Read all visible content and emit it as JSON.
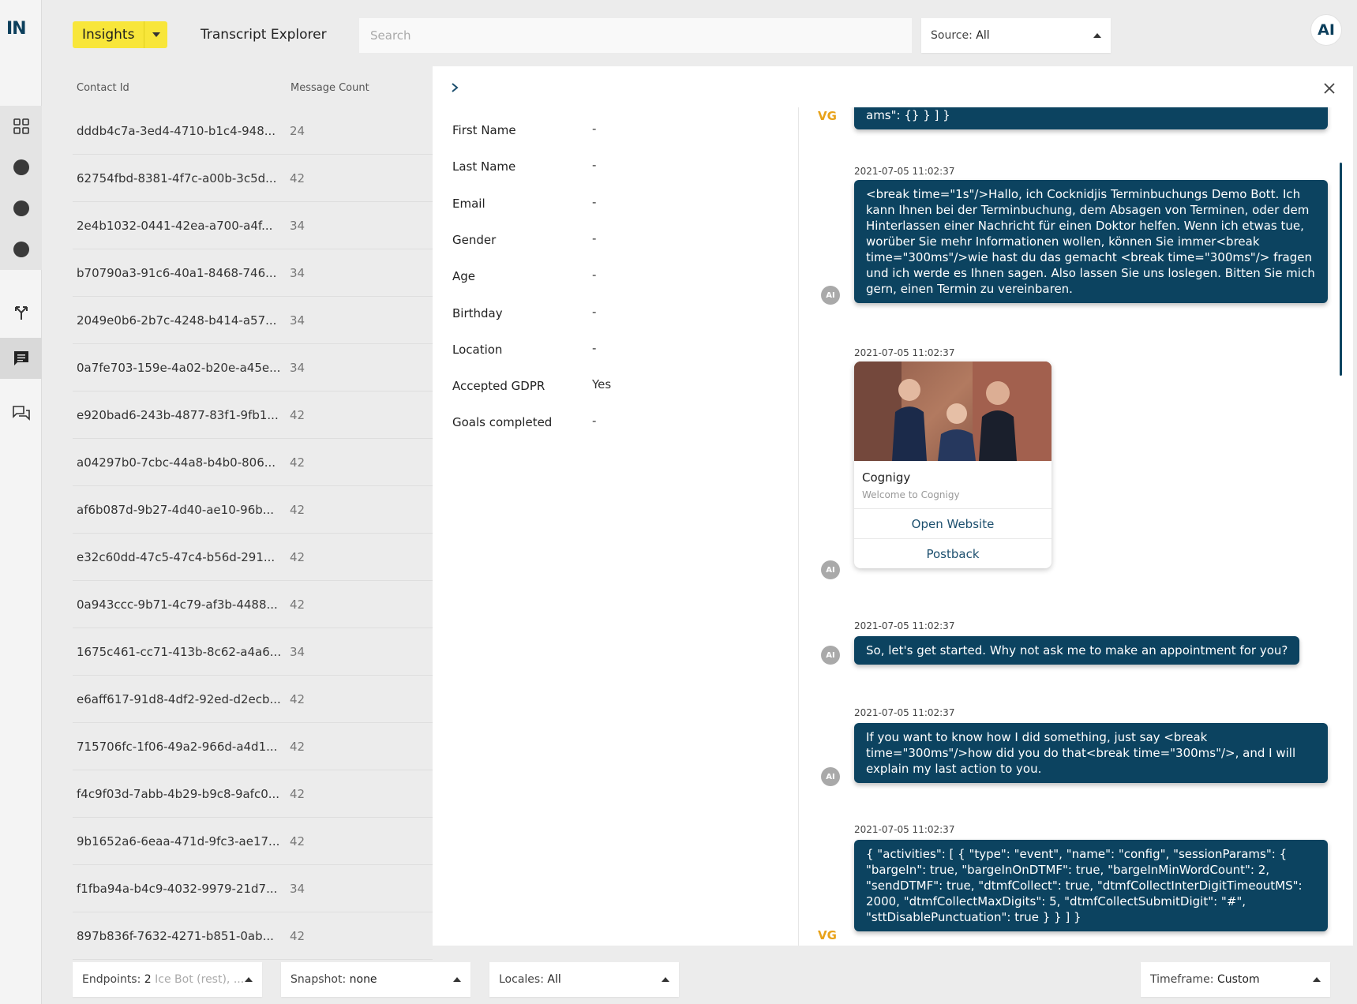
{
  "app": {
    "logo": "IN",
    "brand_logo": "AI"
  },
  "header": {
    "insights_label": "Insights",
    "title": "Transcript Explorer",
    "search_placeholder": "Search",
    "source_label": "Source:",
    "source_value": "All"
  },
  "list": {
    "col_contact": "Contact Id",
    "col_count": "Message Count",
    "rows": [
      {
        "id": "dddb4c7a-3ed4-4710-b1c4-948...",
        "count": "24"
      },
      {
        "id": "62754fbd-8381-4f7c-a00b-3c5d...",
        "count": "42"
      },
      {
        "id": "2e4b1032-0441-42ea-a700-a4f...",
        "count": "34"
      },
      {
        "id": "b70790a3-91c6-40a1-8468-746...",
        "count": "34"
      },
      {
        "id": "2049e0b6-2b7c-4248-b414-a57...",
        "count": "34"
      },
      {
        "id": "0a7fe703-159e-4a02-b20e-a45e...",
        "count": "34"
      },
      {
        "id": "e920bad6-243b-4877-83f1-9fb1...",
        "count": "42"
      },
      {
        "id": "a04297b0-7cbc-44a8-b4b0-806...",
        "count": "42"
      },
      {
        "id": "af6b087d-9b27-4d40-ae10-96b...",
        "count": "42"
      },
      {
        "id": "e32c60dd-47c5-47c4-b56d-291...",
        "count": "42"
      },
      {
        "id": "0a943ccc-9b71-4c79-af3b-4488...",
        "count": "42"
      },
      {
        "id": "1675c461-cc71-413b-8c62-a4a6...",
        "count": "34"
      },
      {
        "id": "e6aff617-91d8-4df2-92ed-d2ecb...",
        "count": "42"
      },
      {
        "id": "715706fc-1f06-49a2-966d-a4d1...",
        "count": "42"
      },
      {
        "id": "f4c9f03d-7abb-4b29-b9c8-9afc0...",
        "count": "42"
      },
      {
        "id": "9b1652a6-6eaa-471d-9fc3-ae17...",
        "count": "42"
      },
      {
        "id": "f1fba94a-b4c9-4032-9979-21d7...",
        "count": "34"
      },
      {
        "id": "897b836f-7632-4271-b851-0ab...",
        "count": "42"
      }
    ]
  },
  "profile": {
    "fields": [
      {
        "label": "First Name",
        "value": "-"
      },
      {
        "label": "Last Name",
        "value": "-"
      },
      {
        "label": "Email",
        "value": "-"
      },
      {
        "label": "Gender",
        "value": "-"
      },
      {
        "label": "Age",
        "value": "-"
      },
      {
        "label": "Birthday",
        "value": "-"
      },
      {
        "label": "Location",
        "value": "-"
      },
      {
        "label": "Accepted GDPR",
        "value": "Yes"
      },
      {
        "label": "Goals completed",
        "value": "-"
      }
    ]
  },
  "chat": {
    "avatar_ai": "AI",
    "avatar_vg": "VG",
    "msg0": "ams\": {} } ] }",
    "ts1": "2021-07-05 11:02:37",
    "msg1": "<break time=\"1s\"/>Hallo, ich Cocknidjis Terminbuchungs Demo Bott. Ich kann Ihnen bei der Terminbuchung, dem Absagen von Terminen, oder dem Hinterlassen einer Nachricht für einen Doktor helfen. Wenn ich etwas tue, worüber Sie mehr Informationen wollen, können Sie immer<break time=\"300ms\"/>wie hast du das gemacht <break time=\"300ms\"/> fragen und ich werde es Ihnen sagen. Also lassen Sie uns loslegen. Bitten Sie mich gern, einen Termin zu vereinbaren.",
    "ts2": "2021-07-05 11:02:37",
    "card": {
      "title": "Cognigy",
      "subtitle": "Welcome to Cognigy",
      "button1": "Open Website",
      "button2": "Postback"
    },
    "ts3": "2021-07-05 11:02:37",
    "msg3": "So, let's get started. Why not ask me to make an appointment for you?",
    "ts4": "2021-07-05 11:02:37",
    "msg4": "If you want to know how I did something, just say <break time=\"300ms\"/>how did you do that<break time=\"300ms\"/>, and I will explain my last action to you.",
    "ts5": "2021-07-05 11:02:37",
    "msg5": "{ \"activities\": [ { \"type\": \"event\", \"name\": \"config\", \"sessionParams\": { \"bargeIn\": true, \"bargeInOnDTMF\": true, \"bargeInMinWordCount\": 2, \"sendDTMF\": true, \"dtmfCollect\": true, \"dtmfCollectInterDigitTimeoutMS\": 2000, \"dtmfCollectMaxDigits\": 5, \"dtmfCollectSubmitDigit\": \"#\", \"sttDisablePunctuation\": true } } ] }"
  },
  "filters": {
    "endpoints_label": "Endpoints:",
    "endpoints_count": "2",
    "endpoints_value": "Ice Bot (rest), ...",
    "snapshot_label": "Snapshot:",
    "snapshot_value": "none",
    "locales_label": "Locales:",
    "locales_value": "All",
    "timeframe_label": "Timeframe:",
    "timeframe_value": "Custom"
  },
  "colors": {
    "accent": "#f8e63a",
    "bubble": "#0c4360",
    "vg": "#e8a21a"
  }
}
